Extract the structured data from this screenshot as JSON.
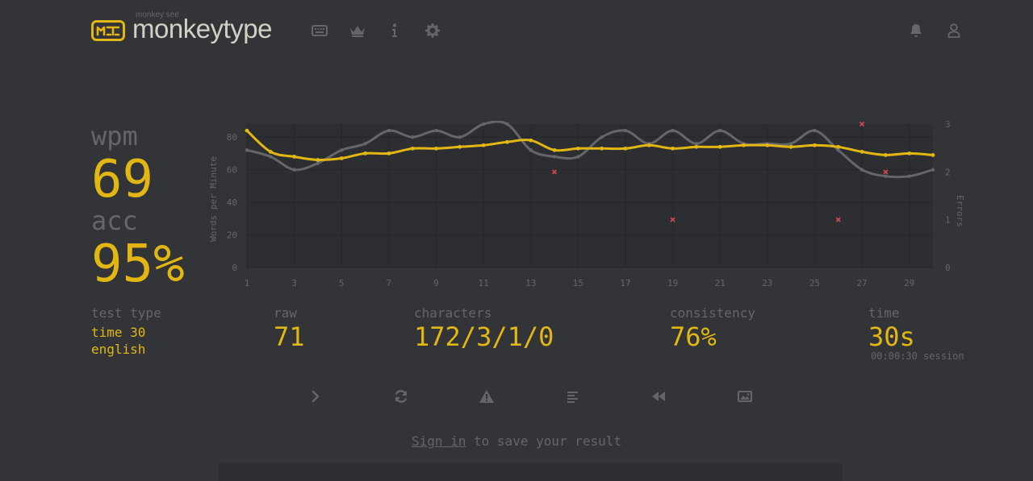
{
  "header": {
    "logo_sub": "monkey see",
    "logo_title": "monkeytype",
    "nav": [
      {
        "name": "keyboard-icon"
      },
      {
        "name": "crown-icon"
      },
      {
        "name": "info-icon"
      },
      {
        "name": "gear-icon"
      }
    ],
    "right": [
      {
        "name": "bell-icon"
      },
      {
        "name": "user-icon"
      }
    ]
  },
  "stats": {
    "wpm_label": "wpm",
    "wpm_value": "69",
    "acc_label": "acc",
    "acc_value": "95%"
  },
  "details": {
    "test_type_label": "test type",
    "test_type_line1": "time 30",
    "test_type_line2": "english",
    "raw_label": "raw",
    "raw_value": "71",
    "characters_label": "characters",
    "characters_value": "172/3/1/0",
    "consistency_label": "consistency",
    "consistency_value": "76%",
    "time_label": "time",
    "time_value": "30s",
    "time_session": "00:00:30 session"
  },
  "actions": [
    {
      "name": "next-test-icon"
    },
    {
      "name": "restart-icon"
    },
    {
      "name": "warning-icon"
    },
    {
      "name": "words-history-icon"
    },
    {
      "name": "replay-icon"
    },
    {
      "name": "screenshot-icon"
    }
  ],
  "signin": {
    "link": "Sign in",
    "rest": " to save your result"
  },
  "colors": {
    "background": "#323437",
    "accent": "#e2b714",
    "sub": "#646669",
    "text": "#d1d0c5",
    "error": "#ca4754"
  },
  "chart_data": {
    "type": "line",
    "y_label": "Words per Minute",
    "y2_label": "Errors",
    "x": [
      1,
      2,
      3,
      4,
      5,
      6,
      7,
      8,
      9,
      10,
      11,
      12,
      13,
      14,
      15,
      16,
      17,
      18,
      19,
      20,
      21,
      22,
      23,
      24,
      25,
      26,
      27,
      28,
      29,
      30
    ],
    "x_ticks": [
      "1",
      "3",
      "5",
      "7",
      "9",
      "11",
      "13",
      "15",
      "17",
      "19",
      "21",
      "23",
      "25",
      "27",
      "29"
    ],
    "y_ticks": [
      "0",
      "20",
      "40",
      "60",
      "80"
    ],
    "y2_ticks": [
      "0",
      "1",
      "2",
      "3"
    ],
    "ylim": [
      0,
      88
    ],
    "y2lim": [
      0,
      3
    ],
    "series": [
      {
        "values": [
          72,
          68,
          60,
          64,
          72,
          76,
          84,
          80,
          84,
          80,
          88,
          88,
          72,
          68,
          68,
          80,
          84,
          76,
          84,
          76,
          84,
          76,
          76,
          76,
          84,
          72,
          60,
          56,
          56,
          60
        ]
      },
      {
        "values": [
          84,
          71,
          68,
          66,
          67,
          70,
          70,
          73,
          73,
          74,
          75,
          77,
          78,
          72,
          73,
          73,
          73,
          75,
          73,
          74,
          74,
          75,
          75,
          74,
          75,
          74,
          71,
          69,
          70,
          69
        ]
      },
      {
        "points": [
          [
            14,
            2
          ],
          [
            19,
            1
          ],
          [
            26,
            1
          ],
          [
            27,
            3
          ],
          [
            28,
            2
          ]
        ]
      }
    ]
  }
}
